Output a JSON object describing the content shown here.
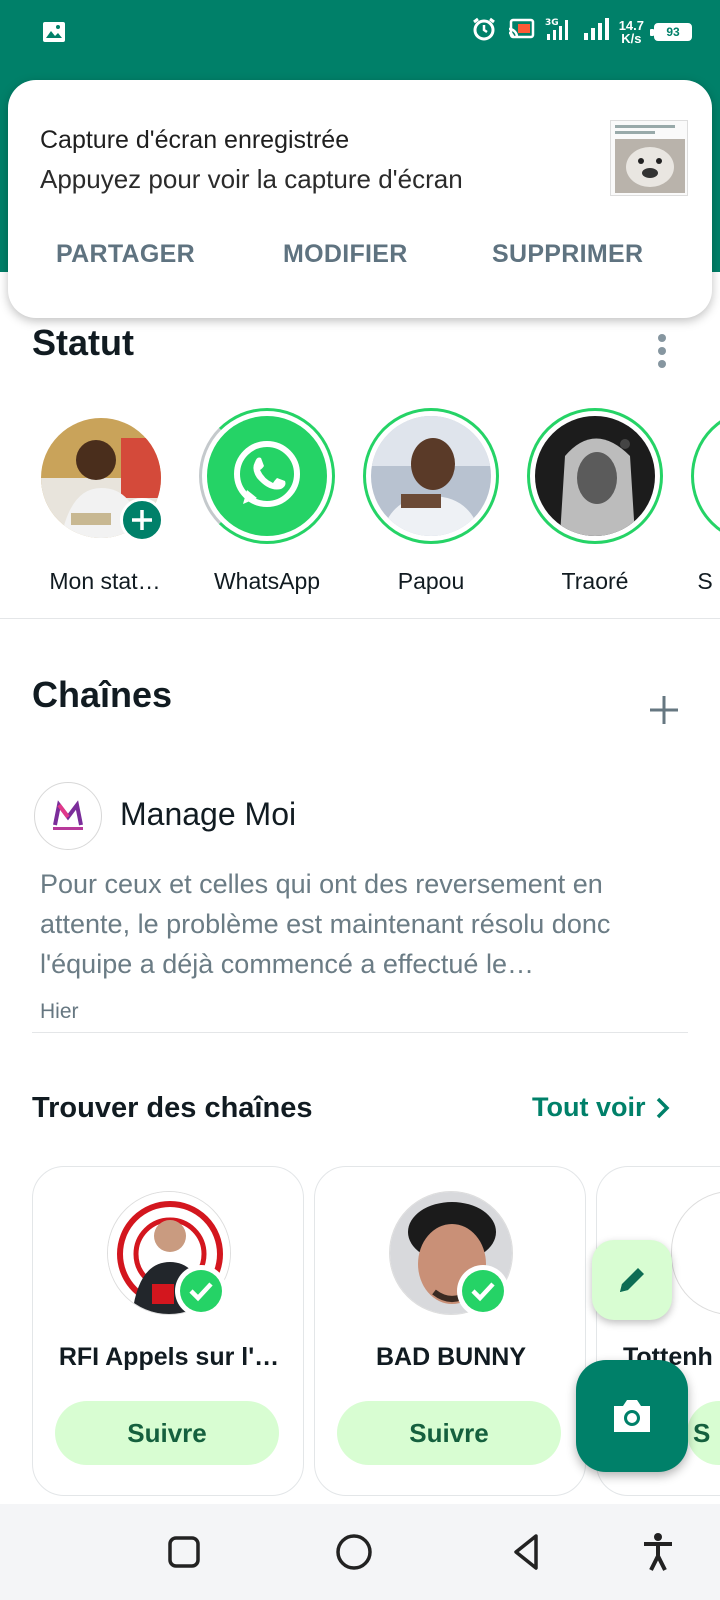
{
  "status_bar": {
    "net_speed_value": "14.7",
    "net_speed_unit": "K/s",
    "battery": "93",
    "icons": [
      "gallery-icon",
      "alarm-icon",
      "cast-icon",
      "signal-3g-icon",
      "signal-icon",
      "battery-icon"
    ]
  },
  "notification": {
    "title": "Capture d'écran enregistrée",
    "subtitle": "Appuyez pour voir la capture d'écran",
    "actions": [
      "PARTAGER",
      "MODIFIER",
      "SUPPRIMER"
    ]
  },
  "status_section": {
    "title": "Statut",
    "stories": [
      {
        "label": "Mon stat…"
      },
      {
        "label": "WhatsApp"
      },
      {
        "label": "Papou"
      },
      {
        "label": "Traoré"
      },
      {
        "label": "S"
      }
    ]
  },
  "channels_section": {
    "title": "Chaînes",
    "channel": {
      "name": "Manage Moi",
      "message": "Pour ceux et celles qui ont des reversement en attente, le problème est maintenant résolu donc l'équipe a déjà commencé a effectué le…",
      "time": "Hier"
    }
  },
  "find_channels": {
    "title": "Trouver des chaînes",
    "see_all": "Tout voir",
    "cards": [
      {
        "name": "RFI Appels sur l'…",
        "follow": "Suivre"
      },
      {
        "name": "BAD BUNNY",
        "follow": "Suivre"
      },
      {
        "name": "Tottenh",
        "follow": "S"
      }
    ]
  },
  "colors": {
    "brand": "#008069",
    "ring": "#25d366",
    "follow_bg": "#d8fdd2"
  }
}
